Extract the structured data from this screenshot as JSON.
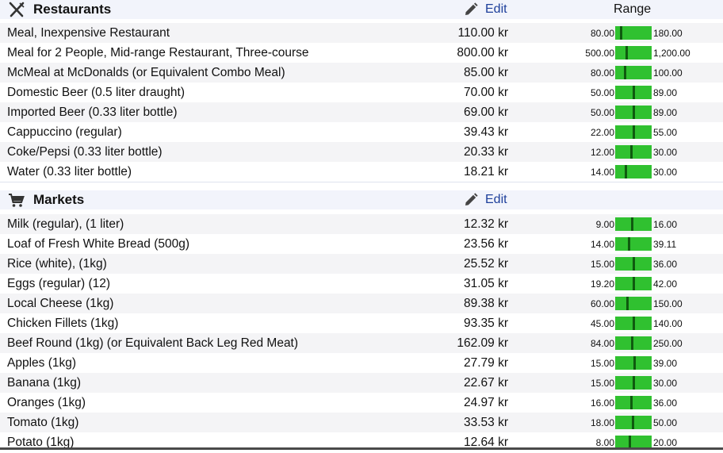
{
  "restaurants": {
    "title": "Restaurants",
    "icon": "fork-knife-icon",
    "edit_label": "Edit",
    "range_label": "Range",
    "items": [
      {
        "name": "Meal, Inexpensive Restaurant",
        "price": "110.00 kr",
        "min": "80.00",
        "max": "180.00",
        "marker": 0.15
      },
      {
        "name": "Meal for 2 People, Mid-range Restaurant, Three-course",
        "price": "800.00 kr",
        "min": "500.00",
        "max": "1,200.00",
        "marker": 0.3
      },
      {
        "name": "McMeal at McDonalds (or Equivalent Combo Meal)",
        "price": "85.00 kr",
        "min": "80.00",
        "max": "100.00",
        "marker": 0.25
      },
      {
        "name": "Domestic Beer (0.5 liter draught)",
        "price": "70.00 kr",
        "min": "50.00",
        "max": "89.00",
        "marker": 0.5
      },
      {
        "name": "Imported Beer (0.33 liter bottle)",
        "price": "69.00 kr",
        "min": "50.00",
        "max": "89.00",
        "marker": 0.5
      },
      {
        "name": "Cappuccino (regular)",
        "price": "39.43 kr",
        "min": "22.00",
        "max": "55.00",
        "marker": 0.5
      },
      {
        "name": "Coke/Pepsi (0.33 liter bottle)",
        "price": "20.33 kr",
        "min": "12.00",
        "max": "30.00",
        "marker": 0.45
      },
      {
        "name": "Water (0.33 liter bottle)",
        "price": "18.21 kr",
        "min": "14.00",
        "max": "30.00",
        "marker": 0.27
      }
    ]
  },
  "markets": {
    "title": "Markets",
    "icon": "shopping-cart-icon",
    "edit_label": "Edit",
    "items": [
      {
        "name": "Milk (regular), (1 liter)",
        "price": "12.32 kr",
        "min": "9.00",
        "max": "16.00",
        "marker": 0.47
      },
      {
        "name": "Loaf of Fresh White Bread (500g)",
        "price": "23.56 kr",
        "min": "14.00",
        "max": "39.11",
        "marker": 0.38
      },
      {
        "name": "Rice (white), (1kg)",
        "price": "25.52 kr",
        "min": "15.00",
        "max": "36.00",
        "marker": 0.5
      },
      {
        "name": "Eggs (regular) (12)",
        "price": "31.05 kr",
        "min": "19.20",
        "max": "42.00",
        "marker": 0.52
      },
      {
        "name": "Local Cheese (1kg)",
        "price": "89.38 kr",
        "min": "60.00",
        "max": "150.00",
        "marker": 0.33
      },
      {
        "name": "Chicken Fillets (1kg)",
        "price": "93.35 kr",
        "min": "45.00",
        "max": "140.00",
        "marker": 0.51
      },
      {
        "name": "Beef Round (1kg) (or Equivalent Back Leg Red Meat)",
        "price": "162.09 kr",
        "min": "84.00",
        "max": "250.00",
        "marker": 0.47
      },
      {
        "name": "Apples (1kg)",
        "price": "27.79 kr",
        "min": "15.00",
        "max": "39.00",
        "marker": 0.53
      },
      {
        "name": "Banana (1kg)",
        "price": "22.67 kr",
        "min": "15.00",
        "max": "30.00",
        "marker": 0.51
      },
      {
        "name": "Oranges (1kg)",
        "price": "24.97 kr",
        "min": "16.00",
        "max": "36.00",
        "marker": 0.45
      },
      {
        "name": "Tomato (1kg)",
        "price": "33.53 kr",
        "min": "18.00",
        "max": "50.00",
        "marker": 0.48
      },
      {
        "name": "Potato (1kg)",
        "price": "12.64 kr",
        "min": "8.00",
        "max": "20.00",
        "marker": 0.39
      }
    ]
  },
  "colors": {
    "bar": "#30c130",
    "marker": "#0f5a0f",
    "link": "#1d3f9b",
    "header_bg": "#f2f4fb",
    "stripe": "#f4f4f6"
  }
}
